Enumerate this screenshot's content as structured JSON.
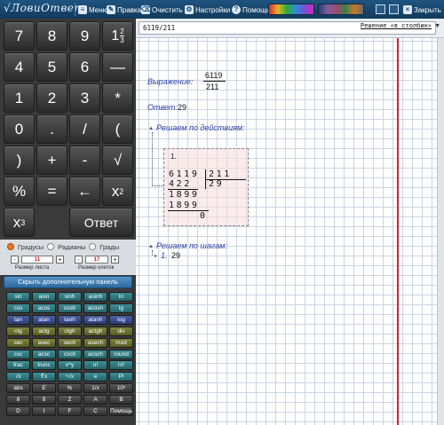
{
  "titlebar": {
    "logo": "√ЛовиОтвет",
    "menu": "Меню",
    "edit": "Правка",
    "clear": "Очистить",
    "settings": "Настройки",
    "help": "Помощь",
    "close": "Закрыть"
  },
  "calc": {
    "keys": [
      "7",
      "8",
      "9",
      "",
      "4",
      "5",
      "6",
      "—",
      "1",
      "2",
      "3",
      "*",
      "0",
      ".",
      "/",
      "(",
      ")",
      "+",
      "-",
      "√",
      "%",
      "=",
      "←",
      "",
      "",
      "Ответ"
    ],
    "mixed_fraction": {
      "whole": "1",
      "num": "2",
      "den": "3"
    },
    "x2": {
      "base": "x",
      "exp": "2"
    },
    "x3": {
      "base": "x",
      "exp": "3"
    },
    "modes": {
      "degrees": "Градусы",
      "radians": "Радианы",
      "grads": "Грады"
    },
    "sheet_size": {
      "label": "Размер листа",
      "value": "11"
    },
    "cell_size": {
      "label": "Размер клеток",
      "value": "17"
    },
    "hide_panel": "Скрыть дополнительную панель"
  },
  "fn_rows": [
    [
      [
        "sin",
        "teal"
      ],
      [
        "asin",
        "teal"
      ],
      [
        "sinh",
        "teal"
      ],
      [
        "asinh",
        "teal"
      ],
      [
        "ln",
        "teal"
      ]
    ],
    [
      [
        "cos",
        "teal"
      ],
      [
        "acos",
        "teal"
      ],
      [
        "cosh",
        "teal"
      ],
      [
        "acosh",
        "teal"
      ],
      [
        "lg",
        "teal"
      ]
    ],
    [
      [
        "tan",
        "blue"
      ],
      [
        "atan",
        "blue"
      ],
      [
        "tanh",
        "blue"
      ],
      [
        "atanh",
        "blue"
      ],
      [
        "log",
        "blue"
      ]
    ],
    [
      [
        "ctg",
        "olive"
      ],
      [
        "actg",
        "olive"
      ],
      [
        "ctgh",
        "olive"
      ],
      [
        "actgh",
        "olive"
      ],
      [
        "div",
        "olive"
      ]
    ],
    [
      [
        "sec",
        "olive"
      ],
      [
        "asec",
        "olive"
      ],
      [
        "sech",
        "olive"
      ],
      [
        "asech",
        "olive"
      ],
      [
        "mod",
        "olive"
      ]
    ],
    [
      [
        "csc",
        "teal"
      ],
      [
        "acsc",
        "teal"
      ],
      [
        "csch",
        "teal"
      ],
      [
        "acsch",
        "teal"
      ],
      [
        "round",
        "teal"
      ]
    ],
    [
      [
        "frac",
        "teal"
      ],
      [
        "trunc",
        "teal"
      ],
      [
        "x^y",
        "teal"
      ],
      [
        "n!",
        "teal"
      ],
      [
        "n!!",
        "teal"
      ]
    ],
    [
      [
        "√x",
        "teal"
      ],
      [
        "∛x",
        "teal"
      ],
      [
        "ⁿ√x",
        "teal"
      ],
      [
        "e",
        "teal"
      ],
      [
        "Pi",
        "teal"
      ]
    ],
    [
      [
        "abs",
        "gray"
      ],
      [
        "E",
        "gray"
      ],
      [
        "%",
        "gray"
      ],
      [
        "1/x",
        "gray"
      ],
      [
        "10ˣ",
        "gray"
      ]
    ],
    [
      [
        "8",
        "gray"
      ],
      [
        "9",
        "gray"
      ],
      [
        "Z",
        "gray"
      ],
      [
        "A",
        "gray"
      ],
      [
        "B",
        "gray"
      ]
    ],
    [
      [
        "D",
        "gray"
      ],
      [
        "I",
        "gray"
      ],
      [
        "F",
        "gray"
      ],
      [
        "C",
        "gray"
      ],
      [
        "Помощь",
        "gray"
      ]
    ]
  ],
  "work": {
    "input_value": "6119/211",
    "method": "Решение «в столбик»",
    "expression_label": "Выражение:",
    "expr_num": "6119",
    "expr_den": "211",
    "answer_label": "Ответ:",
    "answer_value": "29",
    "by_actions": "Решаем по действиям:",
    "step_no": "1.",
    "dividend": "6119",
    "divisor": "211",
    "quotient": "29",
    "sub1": "422",
    "rem1": "1899",
    "sub2": "1899",
    "final_rem": "0",
    "by_steps": "Решаем по шагам:",
    "step_line": "1.",
    "step_value": "29"
  }
}
